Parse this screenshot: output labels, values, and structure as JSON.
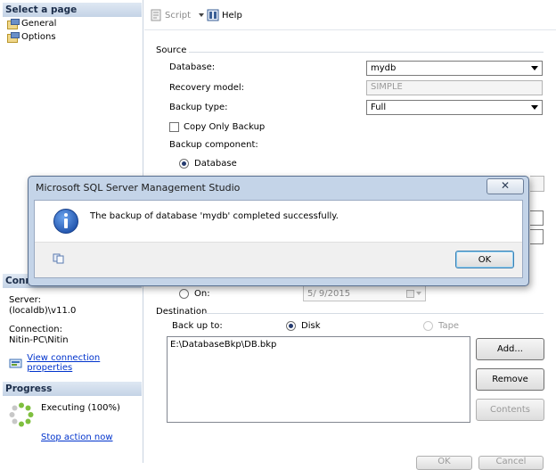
{
  "left_pane": {
    "select_page_header": "Select a page",
    "pages": [
      "General",
      "Options"
    ],
    "connection_header": "Conne",
    "server_label": "Server:",
    "server_value": "(localdb)\\v11.0",
    "connection_label": "Connection:",
    "connection_value": "Nitin-PC\\Nitin",
    "view_connection_link": "View connection properties",
    "progress_header": "Progress",
    "progress_status": "Executing (100%)",
    "stop_action_link": "Stop action now"
  },
  "toolbar": {
    "script_label": "Script",
    "help_label": "Help"
  },
  "source": {
    "group_label": "Source",
    "database_label": "Database:",
    "database_value": "mydb",
    "recovery_model_label": "Recovery model:",
    "recovery_model_value": "SIMPLE",
    "backup_type_label": "Backup type:",
    "backup_type_value": "Full",
    "copy_only_label": "Copy Only Backup",
    "backup_component_label": "Backup component:",
    "component_database_label": "Database"
  },
  "expire": {
    "on_label": "On:",
    "on_date_value": "5/ 9/2015"
  },
  "destination": {
    "group_label": "Destination",
    "back_up_to_label": "Back up to:",
    "disk_label": "Disk",
    "tape_label": "Tape",
    "paths": [
      "E:\\DatabaseBkp\\DB.bkp"
    ],
    "add_label": "Add...",
    "remove_label": "Remove",
    "contents_label": "Contents"
  },
  "bottom_buttons": {
    "ok_label": "OK",
    "cancel_label": "Cancel"
  },
  "dialog": {
    "title": "Microsoft SQL Server Management Studio",
    "close_symbol": "✕",
    "message": "The backup of database 'mydb' completed successfully.",
    "ok_label": "OK"
  }
}
